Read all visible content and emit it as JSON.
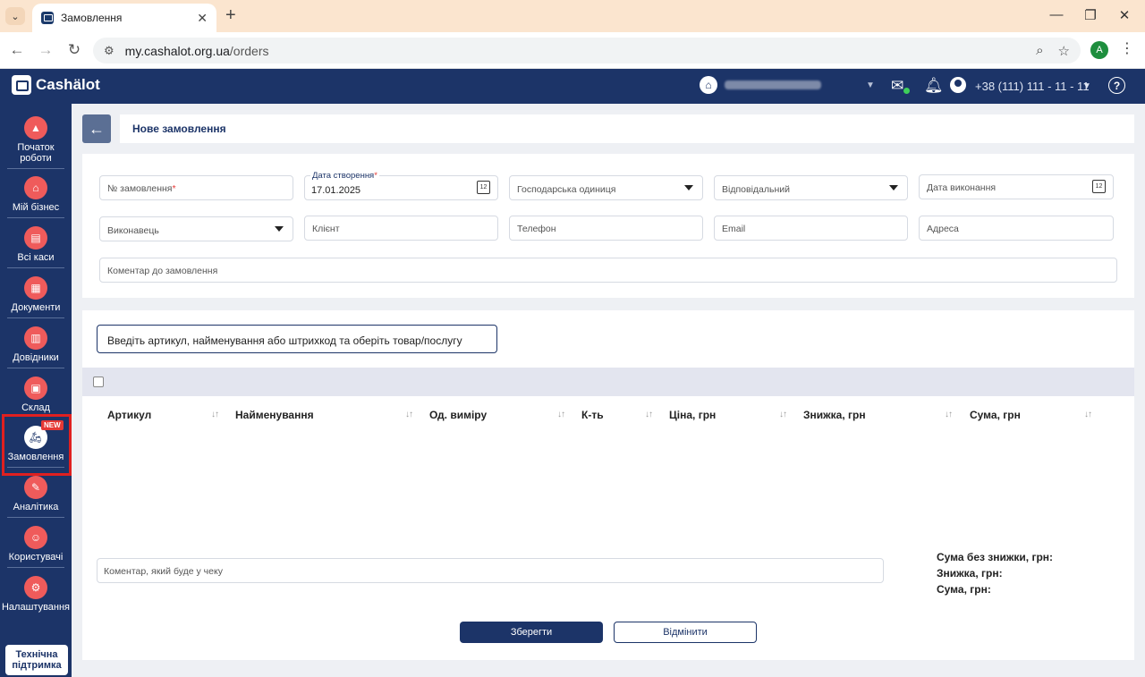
{
  "browser": {
    "tab_title": "Замовлення",
    "url_host": "my.cashalot.org.ua",
    "url_path": "/orders",
    "profile_initial": "A"
  },
  "header": {
    "logo_text": "Cashälot",
    "phone": "+38 (111) 111 - 11 - 11",
    "help_label": "?"
  },
  "sidebar": {
    "items": [
      {
        "label": "Початок роботи",
        "icon": "rocket-icon"
      },
      {
        "label": "Мій бізнес",
        "icon": "home-icon"
      },
      {
        "label": "Всі каси",
        "icon": "register-icon"
      },
      {
        "label": "Документи",
        "icon": "document-icon"
      },
      {
        "label": "Довідники",
        "icon": "book-icon"
      },
      {
        "label": "Склад",
        "icon": "warehouse-icon"
      },
      {
        "label": "Замовлення",
        "icon": "scooter-icon",
        "badge": "NEW"
      },
      {
        "label": "Аналітика",
        "icon": "analytics-icon"
      },
      {
        "label": "Користувачі",
        "icon": "users-icon"
      },
      {
        "label": "Налаштування",
        "icon": "gear-icon"
      }
    ],
    "support_label": "Технічна підтримка"
  },
  "page": {
    "title": "Нове замовлення"
  },
  "form": {
    "order_number": {
      "placeholder": "№ замовлення",
      "required": "*"
    },
    "created_date": {
      "label": "Дата створення",
      "required": "*",
      "value": "17.01.2025"
    },
    "business_unit": {
      "placeholder": "Господарська одиниця"
    },
    "responsible": {
      "placeholder": "Відповідальний"
    },
    "due_date": {
      "placeholder": "Дата виконання"
    },
    "executor": {
      "placeholder": "Виконавець"
    },
    "client": {
      "placeholder": "Клієнт"
    },
    "phone": {
      "placeholder": "Телефон"
    },
    "email": {
      "placeholder": "Email"
    },
    "address": {
      "placeholder": "Адреса"
    },
    "comment": {
      "placeholder": "Коментар до замовлення"
    },
    "calendar_day": "12"
  },
  "items": {
    "search_placeholder": "Введіть артикул, найменування або штрихкод та оберіть товар/послугу",
    "columns": [
      "Артикул",
      "Найменування",
      "Од. виміру",
      "К-ть",
      "Ціна, грн",
      "Знижка, грн",
      "Сума, грн"
    ],
    "receipt_comment_placeholder": "Коментар, який буде у чеку",
    "totals": {
      "subtotal_label": "Сума без знижки, грн:",
      "discount_label": "Знижка, грн:",
      "total_label": "Сума, грн:"
    }
  },
  "actions": {
    "save": "Зберегти",
    "cancel": "Відмінити"
  }
}
